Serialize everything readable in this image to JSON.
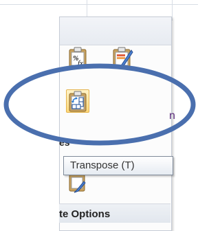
{
  "tooltip": {
    "text": "Transpose (T)"
  },
  "section_partial": {
    "text": "es"
  },
  "footer": {
    "text": "te Options"
  },
  "cut_text": {
    "text": "n"
  },
  "icons": {
    "paste_formulas": "formula-clipboard-icon",
    "paste_formatting": "paintbrush-clipboard-icon",
    "transpose": "transpose-icon",
    "paste_partial": "paste-icon"
  },
  "annotation": {
    "shape": "oval",
    "color": "#4a6fae"
  }
}
